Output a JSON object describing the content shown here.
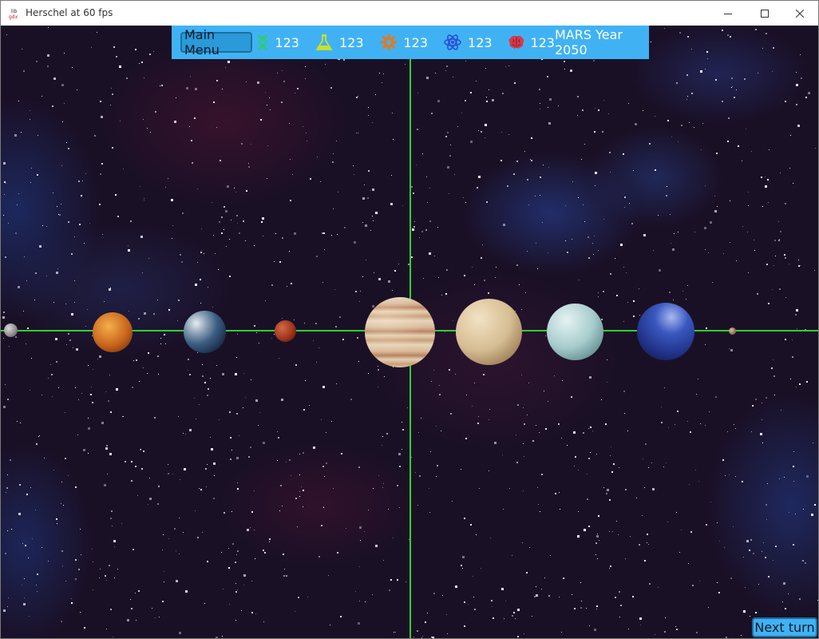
{
  "window": {
    "title": "Herschel at 60 fps"
  },
  "hud": {
    "main_menu_label": "Main Menu",
    "resources": [
      {
        "icon": "dna-icon",
        "value": "123",
        "color": "#2ecc71"
      },
      {
        "icon": "flask-icon",
        "value": "123",
        "color": "#c8e02a"
      },
      {
        "icon": "gear-icon",
        "value": "123",
        "color": "#e07a22"
      },
      {
        "icon": "atom-icon",
        "value": "123",
        "color": "#2a4fd8"
      },
      {
        "icon": "brain-icon",
        "value": "123",
        "color": "#d83a4a"
      }
    ],
    "location_year": "MARS Year 2050"
  },
  "next_turn_label": "Next turn",
  "colors": {
    "hud_bar": "#40b2f4",
    "axis_lines": "#2fd12f"
  }
}
